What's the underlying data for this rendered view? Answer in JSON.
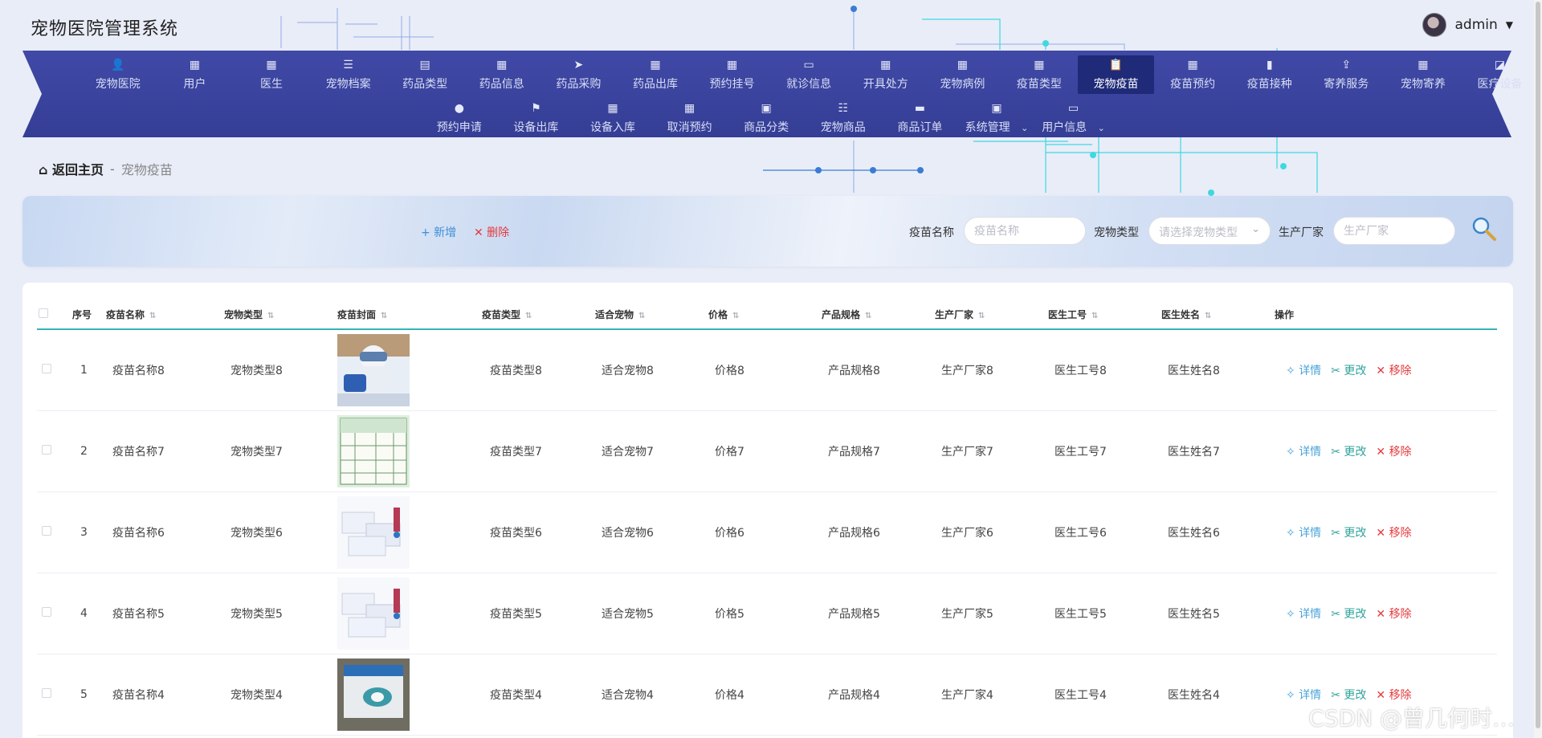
{
  "app": {
    "title": "宠物医院管理系统"
  },
  "user": {
    "name": "admin"
  },
  "nav": {
    "row1": [
      {
        "label": "宠物医院",
        "icon": "person-icon",
        "glyph": "👤"
      },
      {
        "label": "用户",
        "icon": "grid-icon",
        "glyph": "▦"
      },
      {
        "label": "医生",
        "icon": "grid-icon",
        "glyph": "▦"
      },
      {
        "label": "宠物档案",
        "icon": "list-icon",
        "glyph": "☰"
      },
      {
        "label": "药品类型",
        "icon": "inbox-icon",
        "glyph": "▤"
      },
      {
        "label": "药品信息",
        "icon": "grid-icon",
        "glyph": "▦"
      },
      {
        "label": "药品采购",
        "icon": "send-icon",
        "glyph": "➤"
      },
      {
        "label": "药品出库",
        "icon": "grid-icon",
        "glyph": "▦"
      },
      {
        "label": "预约挂号",
        "icon": "grid-icon",
        "glyph": "▦"
      },
      {
        "label": "就诊信息",
        "icon": "monitor-icon",
        "glyph": "▭"
      },
      {
        "label": "开具处方",
        "icon": "grid-icon",
        "glyph": "▦"
      },
      {
        "label": "宠物病例",
        "icon": "grid-icon",
        "glyph": "▦"
      },
      {
        "label": "疫苗类型",
        "icon": "grid-icon",
        "glyph": "▦"
      },
      {
        "label": "宠物疫苗",
        "icon": "clipboard-icon",
        "glyph": "📋"
      },
      {
        "label": "疫苗预约",
        "icon": "grid-icon",
        "glyph": "▦"
      },
      {
        "label": "疫苗接种",
        "icon": "bar-chart-icon",
        "glyph": "▮"
      },
      {
        "label": "寄养服务",
        "icon": "share-icon",
        "glyph": "⇪"
      },
      {
        "label": "宠物寄养",
        "icon": "grid-icon",
        "glyph": "▦"
      },
      {
        "label": "医疗设备",
        "icon": "chart-icon",
        "glyph": "◪"
      }
    ],
    "row2": [
      {
        "label": "预约申请",
        "icon": "bulb-icon",
        "glyph": "●"
      },
      {
        "label": "设备出库",
        "icon": "flag-icon",
        "glyph": "⚑"
      },
      {
        "label": "设备入库",
        "icon": "grid-icon",
        "glyph": "▦"
      },
      {
        "label": "取消预约",
        "icon": "grid-icon",
        "glyph": "▦"
      },
      {
        "label": "商品分类",
        "icon": "task-icon",
        "glyph": "▣"
      },
      {
        "label": "宠物商品",
        "icon": "sliders-icon",
        "glyph": "☷"
      },
      {
        "label": "商品订单",
        "icon": "message-icon",
        "glyph": "▬"
      },
      {
        "label": "系统管理",
        "icon": "clipboard-check-icon",
        "glyph": "▣"
      },
      {
        "label": "用户信息",
        "icon": "window-icon",
        "glyph": "▭"
      }
    ]
  },
  "breadcrumb": {
    "home": "返回主页",
    "sep": "-",
    "current": "宠物疫苗"
  },
  "toolbar": {
    "add_label": "+ 新增",
    "delete_label": "✕ 删除"
  },
  "filters": {
    "name_label": "疫苗名称",
    "name_placeholder": "疫苗名称",
    "type_label": "宠物类型",
    "type_placeholder": "请选择宠物类型",
    "maker_label": "生产厂家",
    "maker_placeholder": "生产厂家"
  },
  "table": {
    "headers": [
      "序号",
      "疫苗名称",
      "宠物类型",
      "疫苗封面",
      "疫苗类型",
      "适合宠物",
      "价格",
      "产品规格",
      "生产厂家",
      "医生工号",
      "医生姓名",
      "操作"
    ],
    "rows": [
      {
        "no": "1",
        "name": "疫苗名称8",
        "pet": "宠物类型8",
        "vtype": "疫苗类型8",
        "suit": "适合宠物8",
        "price": "价格8",
        "spec": "产品规格8",
        "maker": "生产厂家8",
        "docno": "医生工号8",
        "docname": "医生姓名8"
      },
      {
        "no": "2",
        "name": "疫苗名称7",
        "pet": "宠物类型7",
        "vtype": "疫苗类型7",
        "suit": "适合宠物7",
        "price": "价格7",
        "spec": "产品规格7",
        "maker": "生产厂家7",
        "docno": "医生工号7",
        "docname": "医生姓名7"
      },
      {
        "no": "3",
        "name": "疫苗名称6",
        "pet": "宠物类型6",
        "vtype": "疫苗类型6",
        "suit": "适合宠物6",
        "price": "价格6",
        "spec": "产品规格6",
        "maker": "生产厂家6",
        "docno": "医生工号6",
        "docname": "医生姓名6"
      },
      {
        "no": "4",
        "name": "疫苗名称5",
        "pet": "宠物类型5",
        "vtype": "疫苗类型5",
        "suit": "适合宠物5",
        "price": "价格5",
        "spec": "产品规格5",
        "maker": "生产厂家5",
        "docno": "医生工号5",
        "docname": "医生姓名5"
      },
      {
        "no": "5",
        "name": "疫苗名称4",
        "pet": "宠物类型4",
        "vtype": "疫苗类型4",
        "suit": "适合宠物4",
        "price": "价格4",
        "spec": "产品规格4",
        "maker": "生产厂家4",
        "docno": "医生工号4",
        "docname": "医生姓名4"
      }
    ],
    "actions": {
      "detail": "详情",
      "edit": "更改",
      "remove": "移除"
    }
  },
  "watermark": "CSDN @曾几何时…"
}
